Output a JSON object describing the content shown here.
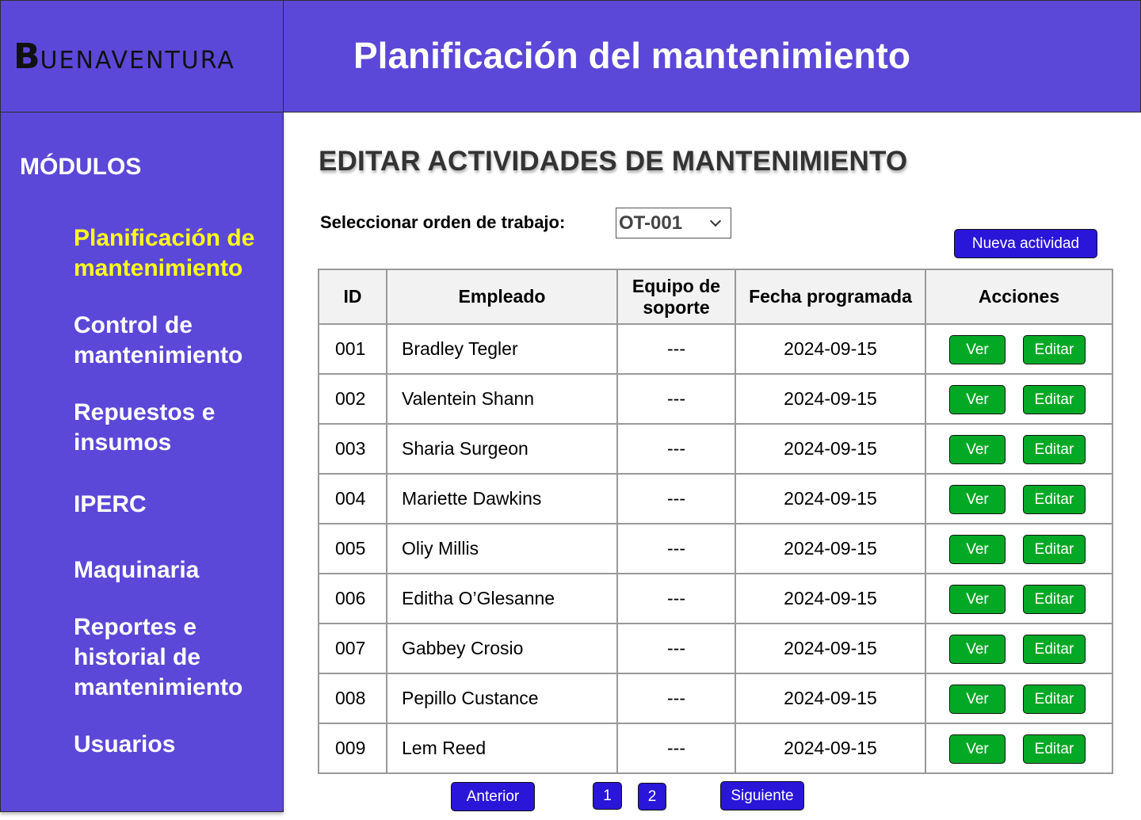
{
  "brand": {
    "logo_initial": "B",
    "logo_rest": "UENAVENTURA"
  },
  "header": {
    "title": "Planificación del mantenimiento"
  },
  "sidebar": {
    "heading": "MÓDULOS",
    "items": [
      {
        "label": "Planificación de mantenimiento",
        "active": true
      },
      {
        "label": "Control de mantenimiento"
      },
      {
        "label": "Repuestos e insumos"
      },
      {
        "label": "IPERC"
      },
      {
        "label": "Maquinaria"
      },
      {
        "label": "Reportes e historial de mantenimiento"
      },
      {
        "label": "Usuarios"
      }
    ]
  },
  "main": {
    "title": "EDITAR ACTIVIDADES DE MANTENIMIENTO",
    "select_label": "Seleccionar orden de trabajo:",
    "select_value": "OT-001",
    "new_button": "Nueva actividad",
    "columns": [
      "ID",
      "Empleado",
      "Equipo de soporte",
      "Fecha programada",
      "Acciones"
    ],
    "rows": [
      {
        "id": "001",
        "employee": "Bradley Tegler",
        "equipment": "---",
        "date": "2024-09-15"
      },
      {
        "id": "002",
        "employee": " Valentein Shann",
        "equipment": "---",
        "date": "2024-09-15"
      },
      {
        "id": "003",
        "employee": "Sharia Surgeon",
        "equipment": "---",
        "date": "2024-09-15"
      },
      {
        "id": "004",
        "employee": "Mariette Dawkins",
        "equipment": "---",
        "date": "2024-09-15"
      },
      {
        "id": "005",
        "employee": "Oliy Millis",
        "equipment": "---",
        "date": "2024-09-15"
      },
      {
        "id": "006",
        "employee": "Editha O’Glesanne",
        "equipment": "---",
        "date": "2024-09-15"
      },
      {
        "id": "007",
        "employee": "Gabbey Crosio",
        "equipment": "---",
        "date": "2024-09-15"
      },
      {
        "id": "008",
        "employee": "Pepillo Custance",
        "equipment": "---",
        "date": "2024-09-15"
      },
      {
        "id": "009",
        "employee": "Lem Reed",
        "equipment": "---",
        "date": "2024-09-15"
      }
    ],
    "view_label": "Ver",
    "edit_label": "Editar",
    "pagination": {
      "prev": "Anterior",
      "pages": [
        "1",
        "2"
      ],
      "next": "Siguiente"
    }
  },
  "colors": {
    "primary": "#5B48D8",
    "active_nav": "#FFFF1A",
    "button_blue": "#2A16D8",
    "button_green": "#03A925"
  },
  "icons": {
    "select_toggle": "chevron-down-icon"
  }
}
